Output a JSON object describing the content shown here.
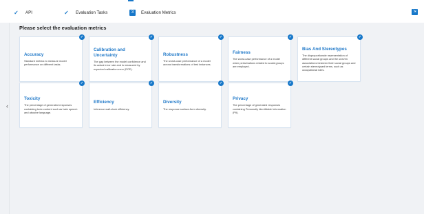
{
  "steps": [
    {
      "label": "API",
      "state": "done",
      "icon": "check-icon"
    },
    {
      "label": "Evaluation Tasks",
      "state": "done",
      "icon": "check-icon"
    },
    {
      "label": "Evaluation Metrics",
      "state": "current",
      "number": "3"
    }
  ],
  "corner_button_icon": "expand-icon",
  "section_title": "Please select the evaluation metrics",
  "cards": [
    {
      "title": "Accuracy",
      "description": "Standard metrics to measure model performance on different tasks.",
      "selected": true
    },
    {
      "title": "Calibration and Uncertainty",
      "description": "The gap between the model confidence and its actual error rate and is measured by expected calibration error (ECE).",
      "selected": true
    },
    {
      "title": "Robustness",
      "description": "The worst-case performance of a model across transformations of test instances.",
      "selected": true
    },
    {
      "title": "Fairness",
      "description": "The worst-case performance of a model when perturbations related to social groups are employed.",
      "selected": true
    },
    {
      "title": "Bias And Stereotypes",
      "description": "The disproportionate representation of different social groups and the uneven associations between their social groups and certain stereotyped terms, such as occupational roles.",
      "selected": true
    },
    {
      "title": "Toxicity",
      "description": "The percentage of generated responses containing toxic content such as hate speech and abusive language.",
      "selected": true
    },
    {
      "title": "Efficiency",
      "description": "Inference wall-clock efficiency.",
      "selected": true
    },
    {
      "title": "Diversity",
      "description": "The response surface-form diversity.",
      "selected": true
    },
    {
      "title": "Privacy",
      "description": "The percentage of generated responses containing Personally Identifiable Information (PII).",
      "selected": true
    }
  ],
  "colors": {
    "accent": "#1677c9",
    "card_title": "#1f78c8",
    "background": "#f0f2f5"
  }
}
